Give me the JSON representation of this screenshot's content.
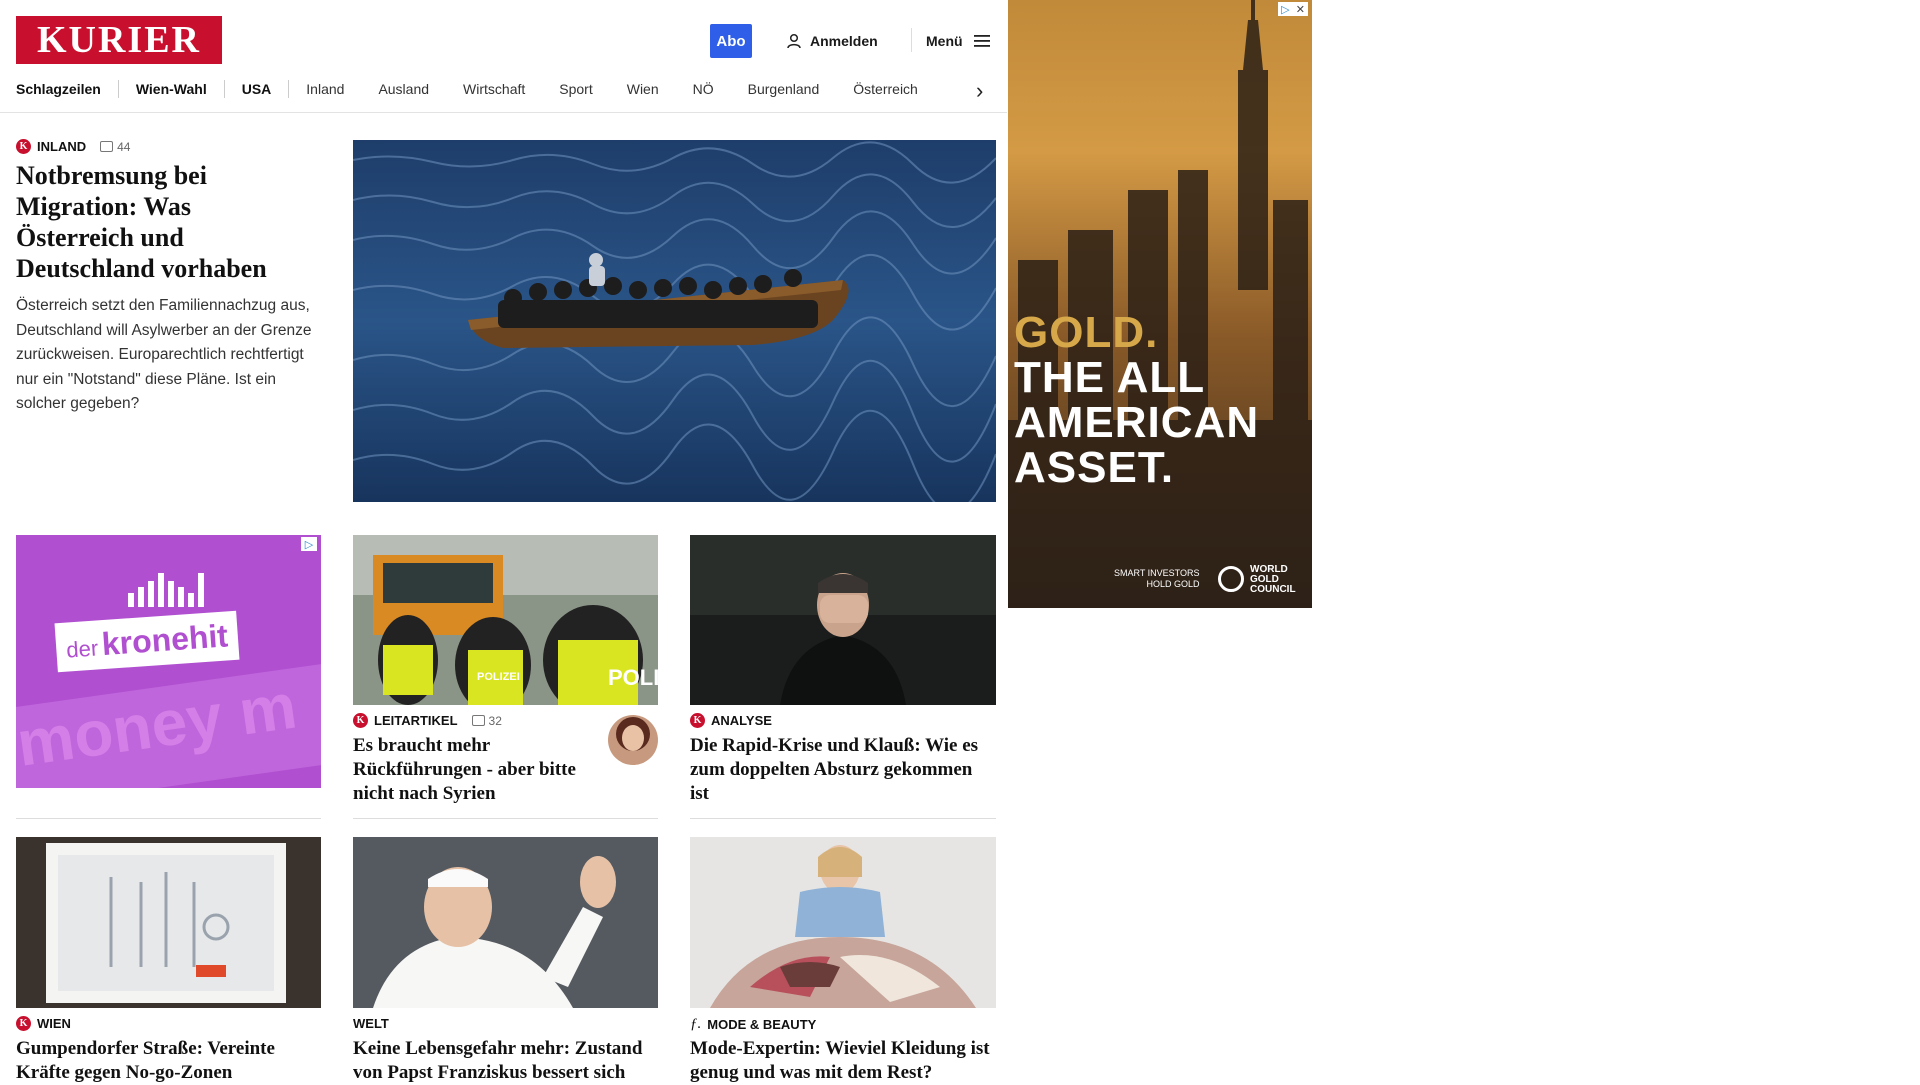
{
  "header": {
    "logo": "KURIER",
    "abo_label": "Abo",
    "login_label": "Anmelden",
    "menu_label": "Menü"
  },
  "nav": {
    "items": [
      "Schlagzeilen",
      "Wien-Wahl",
      "USA",
      "Inland",
      "Ausland",
      "Wirtschaft",
      "Sport",
      "Wien",
      "NÖ",
      "Burgenland",
      "Österreich"
    ]
  },
  "lead": {
    "category": "INLAND",
    "comments": "44",
    "headline": "Notbremsung bei Migration: Was Österreich und Deutschland vorhaben",
    "teaser": "Österreich setzt den Familiennachzug aus, Deutschland will Asylwerber an der Grenze zurückweisen. Europarechtlich rechtfertigt nur ein \"Notstand\" diese Pläne. Ist ein solcher gegeben?"
  },
  "ad_left": {
    "brand_prefix": "der",
    "brand_main": "kronehit",
    "bg_text": "money m"
  },
  "ad_right": {
    "line1": "GOLD.",
    "line2": "THE ALL",
    "line3": "AMERICAN",
    "line4": "ASSET.",
    "footer_left1": "SMART INVESTORS",
    "footer_left2": "HOLD GOLD",
    "footer_right1": "WORLD",
    "footer_right2": "GOLD",
    "footer_right3": "COUNCIL"
  },
  "articles": [
    {
      "category": "LEITARTIKEL",
      "comments": "32",
      "headline": "Es braucht mehr Rückführungen - aber bitte nicht nach Syrien",
      "image": "polizei"
    },
    {
      "category": "ANALYSE",
      "headline": "Die Rapid-Krise und Klauß: Wie es zum doppelten Absturz gekommen ist",
      "image": "trainer"
    },
    {
      "category": "WIEN",
      "headline": "Gumpendorfer Straße: Vereinte Kräfte gegen No-go-Zonen",
      "image": "spritzen"
    },
    {
      "category": "WELT",
      "headline": "Keine Lebensgefahr mehr: Zustand von Papst Franziskus bessert sich",
      "image": "papst"
    },
    {
      "category": "MODE & BEAUTY",
      "headline": "Mode-Expertin: Wieviel Kleidung ist genug und was mit dem Rest?",
      "image": "kleidung"
    }
  ],
  "colors": {
    "brand": "#c8102e",
    "abo": "#2f5fe8",
    "ad_purple": "#b04fd0"
  }
}
